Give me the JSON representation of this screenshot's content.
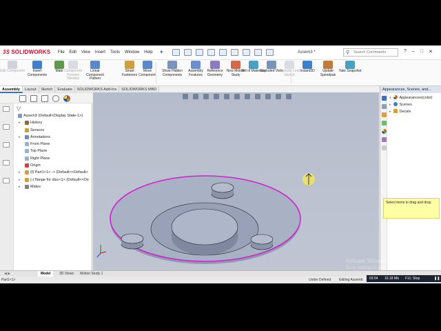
{
  "app": {
    "logo_prefix": "3S",
    "logo_text": "SOLIDWORKS",
    "document_title": "Assem3 *",
    "search_placeholder": "Search Commands"
  },
  "menu": [
    "File",
    "Edit",
    "View",
    "Insert",
    "Tools",
    "Window",
    "Help"
  ],
  "ribbon": [
    {
      "label": "Edit Component",
      "enabled": false
    },
    {
      "label": "Insert Components",
      "enabled": true
    },
    {
      "label": "Mate",
      "enabled": true
    },
    {
      "label": "Component Preview Window",
      "enabled": false
    },
    {
      "label": "Linear Component Pattern",
      "enabled": true
    },
    {
      "label": "Smart Fasteners",
      "enabled": true
    },
    {
      "label": "Move Component",
      "enabled": true
    },
    {
      "label": "Show Hidden Components",
      "enabled": true
    },
    {
      "label": "Assembly Features",
      "enabled": true
    },
    {
      "label": "Reference Geometry",
      "enabled": true
    },
    {
      "label": "New Motion Study",
      "enabled": true
    },
    {
      "label": "Bill of Materials",
      "enabled": true
    },
    {
      "label": "Exploded View",
      "enabled": true
    },
    {
      "label": "Explode Line Sketch",
      "enabled": false
    },
    {
      "label": "Instant3D",
      "enabled": true
    },
    {
      "label": "Update Speedpak",
      "enabled": true
    },
    {
      "label": "Take Snapshot",
      "enabled": true
    }
  ],
  "tabs": [
    "Assembly",
    "Layout",
    "Sketch",
    "Evaluate",
    "SOLIDWORKS Add-Ins",
    "SOLIDWORKS MBD"
  ],
  "active_tab": "Assembly",
  "tree": {
    "root": "Assem3 (Default<Display State-1>)",
    "items": [
      {
        "label": "History",
        "expandable": true,
        "icon": "history-icon"
      },
      {
        "label": "Sensors",
        "expandable": false,
        "icon": "sensor-icon"
      },
      {
        "label": "Annotations",
        "expandable": true,
        "icon": "annotations-icon"
      },
      {
        "label": "Front Plane",
        "expandable": false,
        "icon": "plane-icon"
      },
      {
        "label": "Top Plane",
        "expandable": false,
        "icon": "plane-icon"
      },
      {
        "label": "Right Plane",
        "expandable": false,
        "icon": "plane-icon"
      },
      {
        "label": "Origin",
        "expandable": false,
        "icon": "origin-icon"
      },
      {
        "label": "(f) Part1<1> -> (Default<<Default>",
        "expandable": true,
        "icon": "part-icon"
      },
      {
        "label": "(-) flange for disc<1> (Default<<De",
        "expandable": true,
        "icon": "part-icon"
      },
      {
        "label": "Mates",
        "expandable": true,
        "icon": "mates-icon"
      }
    ]
  },
  "task_pane": {
    "title": "Appearances, Scenes, and...",
    "items": [
      {
        "label": "Appearances(color)",
        "color": "#c0392b"
      },
      {
        "label": "Scenes",
        "color": "#3a7fc8"
      },
      {
        "label": "Decals",
        "color": "#e0a020"
      }
    ],
    "hint": "Select items to drag and drop."
  },
  "bottom_tabs": [
    "Model",
    "3D Views",
    "Motion Study 1"
  ],
  "active_bottom_tab": "Model",
  "status": {
    "part": "Part1<1>",
    "state": "Under Defined",
    "mode": "Editing Assemb"
  },
  "tray": {
    "time": "03:54",
    "size": "16.18 Mb",
    "key": "F11: Stop"
  },
  "watermark": {
    "title": "Activate Windows",
    "subtitle": "Go to Settings to activate Windows."
  },
  "colors": {
    "selection_edge": "#d020d0",
    "viewport_bg": "#b9c0cd",
    "model_face": "#a4adc2",
    "accent": "#3a6fc4"
  }
}
